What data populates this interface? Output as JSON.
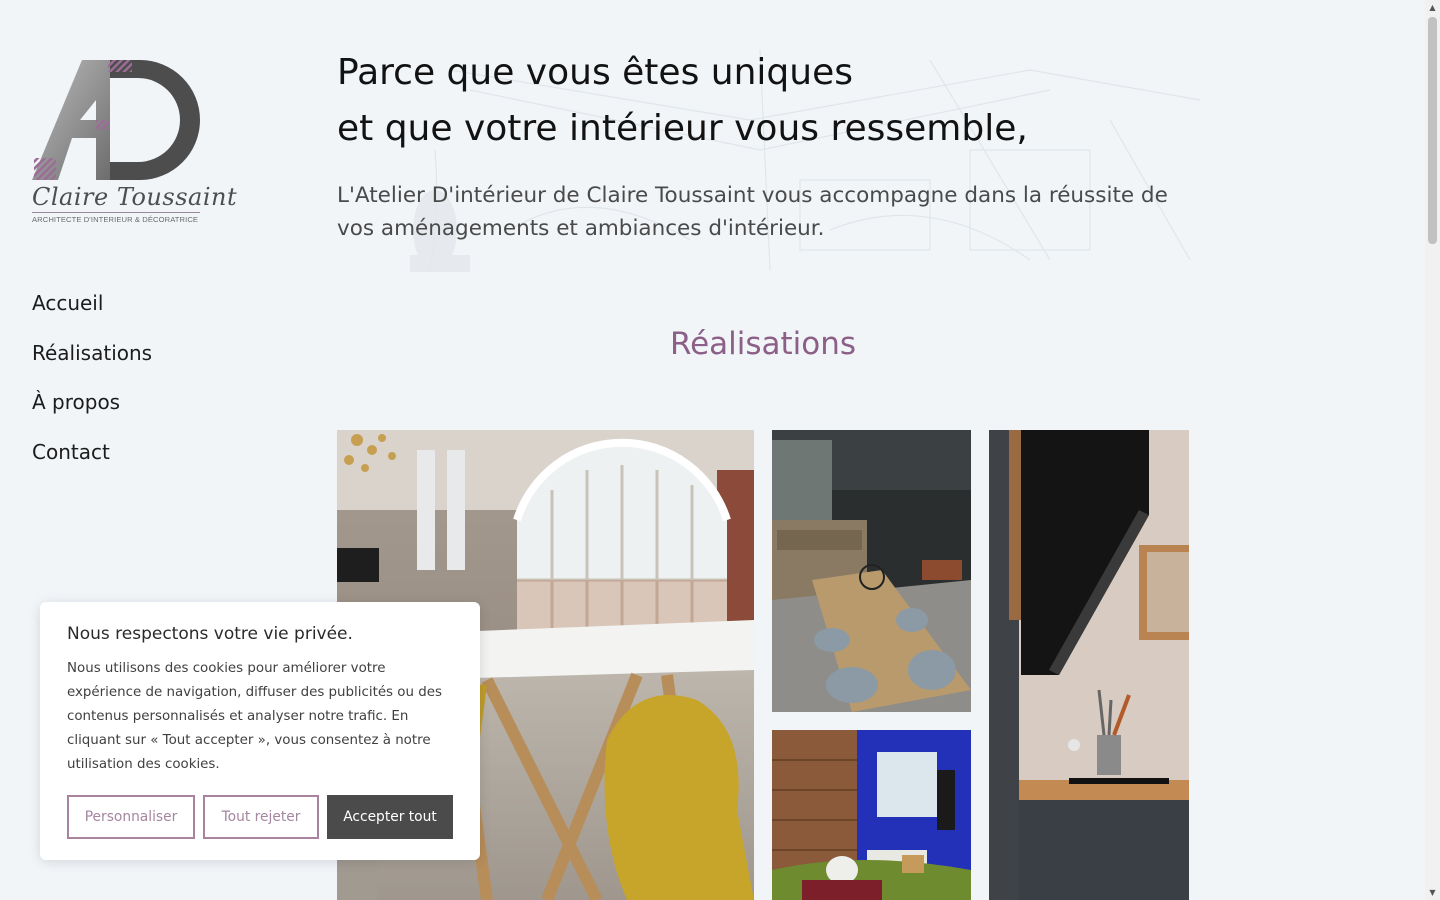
{
  "logo": {
    "script_name": "Claire Toussaint",
    "subtitle": "ARCHITECTE D'INTERIEUR & DÉCORATRICE"
  },
  "nav": {
    "items": [
      {
        "label": "Accueil"
      },
      {
        "label": "Réalisations"
      },
      {
        "label": "À propos"
      },
      {
        "label": "Contact"
      }
    ]
  },
  "hero": {
    "title_line1": "Parce que vous êtes uniques",
    "title_line2": "et que votre intérieur vous ressemble,",
    "subtitle": "L'Atelier D'intérieur de Claire Toussaint vous accompagne dans la réussite de vos aménagements et ambiances d'intérieur."
  },
  "section": {
    "title": "Réalisations"
  },
  "gallery": {
    "images": [
      {
        "name": "dining-room-arched-window"
      },
      {
        "name": "dining-table-dark-kitchen"
      },
      {
        "name": "blue-living-room"
      },
      {
        "name": "black-kitchen-hood"
      }
    ]
  },
  "cookie": {
    "title": "Nous respectons votre vie privée.",
    "text": "Nous utilisons des cookies pour améliorer votre expérience de navigation, diffuser des publicités ou des contenus personnalisés et analyser notre trafic. En cliquant sur « Tout accepter », vous consentez à notre utilisation des cookies.",
    "customize_label": "Personnaliser",
    "reject_label": "Tout rejeter",
    "accept_label": "Accepter tout"
  },
  "colors": {
    "accent": "#8b5f87",
    "background": "#f1f5f8",
    "button_dark": "#4b4b4b"
  },
  "icons": {
    "scroll_up": "▲",
    "scroll_down": "▼"
  }
}
